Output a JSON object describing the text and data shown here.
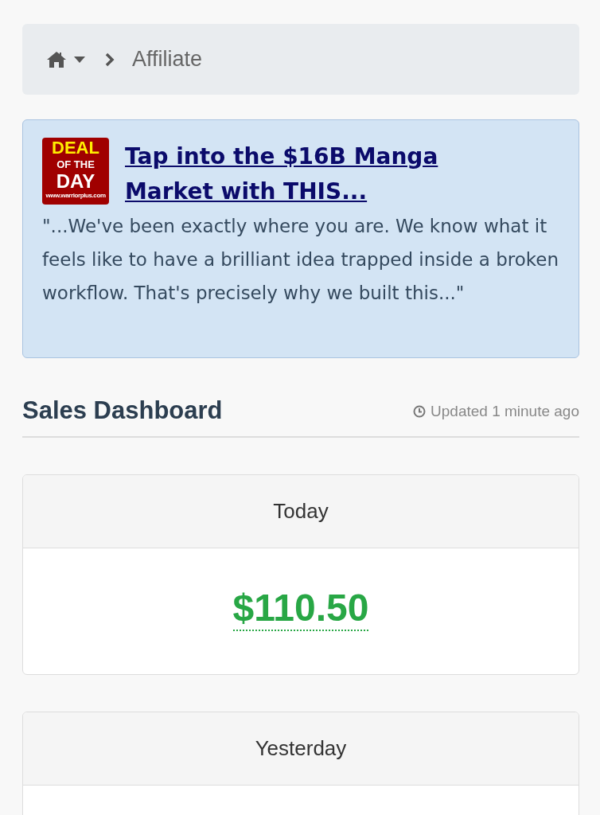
{
  "breadcrumb": {
    "items": [
      {
        "label": "Affiliate"
      }
    ]
  },
  "ad": {
    "badge": [
      "DEAL",
      "OF THE",
      "DAY"
    ],
    "badge_url": "www.warriorplus.com",
    "title": "Tap into the $16B Manga Market with THIS...",
    "text": "\"...We've been exactly where you are. We know what it feels like to have a brilliant idea trapped inside a broken workflow. That's precisely why we built this...\""
  },
  "dashboard": {
    "title": "Sales Dashboard",
    "updated": "Updated 1 minute ago"
  },
  "cards": [
    {
      "label": "Today",
      "amount": "$110.50"
    },
    {
      "label": "Yesterday"
    }
  ]
}
